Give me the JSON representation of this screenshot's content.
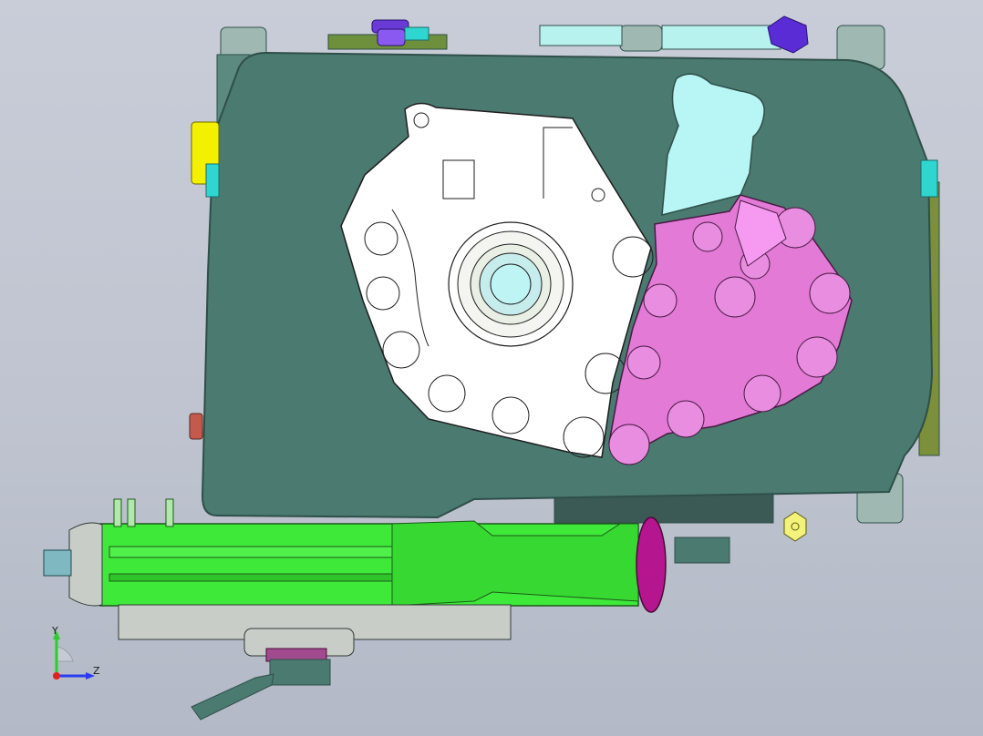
{
  "viewport": {
    "background_top": "#c9cdd8",
    "background_bottom": "#b3b9c6"
  },
  "model": {
    "colors": {
      "housing": "#4a7a70",
      "housing_edge": "#2f4f49",
      "cover_plate": "#ffffff",
      "pump_body": "#e27ad6",
      "pump_highlight": "#f59af0",
      "bracket": "#b8f6f6",
      "shaft": "#3fe93a",
      "shaft_dark": "#27a824",
      "flange": "#b5168f",
      "bolt": "#5a2cd6",
      "yellow_part": "#f3f000",
      "cyan_part": "#2fd6d0",
      "grey_part": "#c9cdc8",
      "nut": "#f3f27a",
      "red_plug": "#c45a4c"
    }
  },
  "triad": {
    "y_label": "Y",
    "z_label": "Z",
    "y_color": "#2ecc2e",
    "z_color": "#2a3cf2",
    "x_color": "#e02020"
  }
}
